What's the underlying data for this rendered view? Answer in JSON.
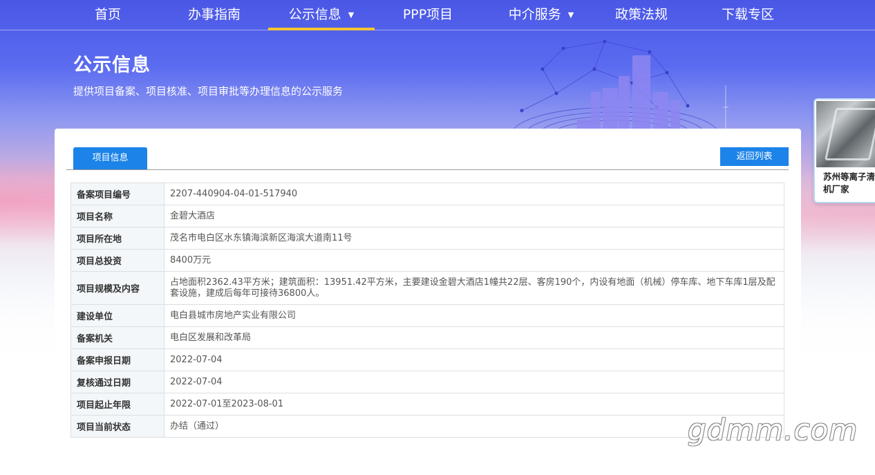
{
  "nav": {
    "items": [
      {
        "label": "首页"
      },
      {
        "label": "办事指南"
      },
      {
        "label": "公示信息",
        "caret": "▼"
      },
      {
        "label": "PPP项目"
      },
      {
        "label": "中介服务",
        "caret": "▼"
      },
      {
        "label": "政策法规"
      },
      {
        "label": "下载专区"
      }
    ],
    "active_index": 2,
    "active_color": "#f5c531"
  },
  "header": {
    "title": "公示信息",
    "subtitle": "提供项目备案、项目核准、项目审批等办理信息的公示服务"
  },
  "side_ad": {
    "text": "苏州等离子清洗机厂家"
  },
  "panel": {
    "tab_label": "项目信息",
    "back_label": "返回列表",
    "accent_color": "#1c83e8"
  },
  "project": {
    "rows": [
      {
        "key": "备案项目编号",
        "value": "2207-440904-04-01-517940"
      },
      {
        "key": "项目名称",
        "value": "金碧大酒店"
      },
      {
        "key": "项目所在地",
        "value": "茂名市电白区水东镇海滨新区海滨大道南11号"
      },
      {
        "key": "项目总投资",
        "value": "8400万元"
      },
      {
        "key": "项目规模及内容",
        "value": "占地面积2362.43平方米；建筑面积：13951.42平方米，主要建设金碧大酒店1幢共22层、客房190个，内设有地面（机械）停车库、地下车库1层及配套设施，建成后每年可接待36800人。"
      },
      {
        "key": "建设单位",
        "value": "电白县城市房地产实业有限公司"
      },
      {
        "key": "备案机关",
        "value": "电白区发展和改革局"
      },
      {
        "key": "备案申报日期",
        "value": "2022-07-04"
      },
      {
        "key": "复核通过日期",
        "value": "2022-07-04"
      },
      {
        "key": "项目起止年限",
        "value": "2022-07-01至2023-08-01"
      },
      {
        "key": "项目当前状态",
        "value": "办结（通过）"
      }
    ]
  },
  "watermark": "gdmm.com"
}
